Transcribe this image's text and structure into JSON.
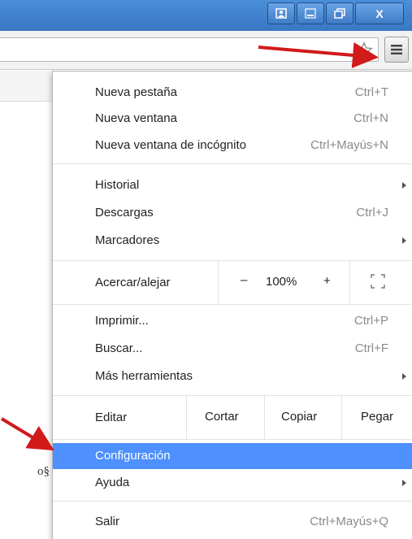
{
  "window": {
    "controls": {
      "user_icon": "user-icon",
      "minimize": "minimize-icon",
      "restore": "restore-icon",
      "close": "close-icon"
    },
    "close_label": "X"
  },
  "toolbar": {
    "star_icon": "star-icon",
    "menu_icon": "hamburger-menu-icon"
  },
  "menu": {
    "group1": [
      {
        "label": "Nueva pestaña",
        "shortcut": "Ctrl+T"
      },
      {
        "label": "Nueva ventana",
        "shortcut": "Ctrl+N"
      },
      {
        "label": "Nueva ventana de incógnito",
        "shortcut": "Ctrl+Mayús+N"
      }
    ],
    "group2": [
      {
        "label": "Historial",
        "submenu": true
      },
      {
        "label": "Descargas",
        "shortcut": "Ctrl+J"
      },
      {
        "label": "Marcadores",
        "submenu": true
      }
    ],
    "zoom": {
      "label": "Acercar/alejar",
      "minus": "–",
      "value": "100%",
      "plus": "+",
      "fullscreen_icon": "fullscreen-icon"
    },
    "group3": [
      {
        "label": "Imprimir...",
        "shortcut": "Ctrl+P"
      },
      {
        "label": "Buscar...",
        "shortcut": "Ctrl+F"
      },
      {
        "label": "Más herramientas",
        "submenu": true
      }
    ],
    "edit": {
      "label": "Editar",
      "cut": "Cortar",
      "copy": "Copiar",
      "paste": "Pegar"
    },
    "group4": [
      {
        "label": "Configuración",
        "highlighted": true
      },
      {
        "label": "Ayuda",
        "submenu": true
      }
    ],
    "exit": {
      "label": "Salir",
      "shortcut": "Ctrl+Mayús+Q"
    }
  },
  "page": {
    "partial_text": "ο§"
  },
  "colors": {
    "highlight": "#4d90fe",
    "annotation_arrow": "#d11a1a",
    "titlebar": "#3f7fcb"
  }
}
